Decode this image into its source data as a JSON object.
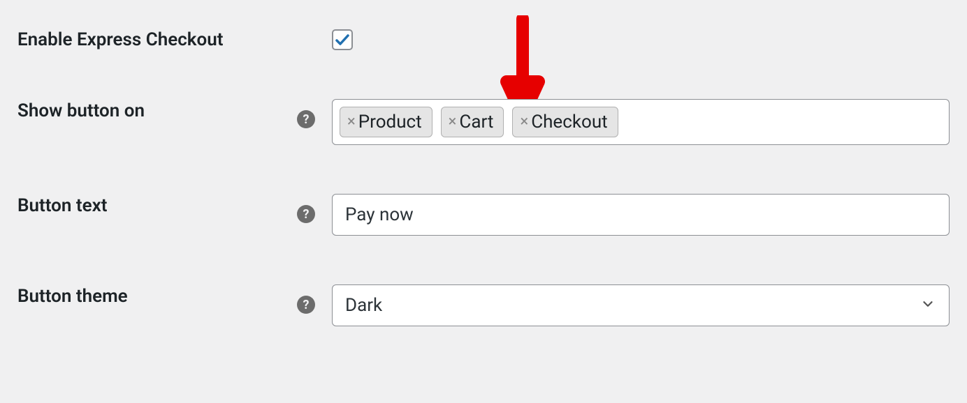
{
  "rows": {
    "enable": {
      "label": "Enable Express Checkout",
      "checked": true
    },
    "show_on": {
      "label": "Show button on",
      "tags": [
        "Product",
        "Cart",
        "Checkout"
      ]
    },
    "button_text": {
      "label": "Button text",
      "value": "Pay now"
    },
    "button_theme": {
      "label": "Button theme",
      "value": "Dark"
    }
  },
  "annotation": {
    "arrow_color": "#e60000"
  }
}
